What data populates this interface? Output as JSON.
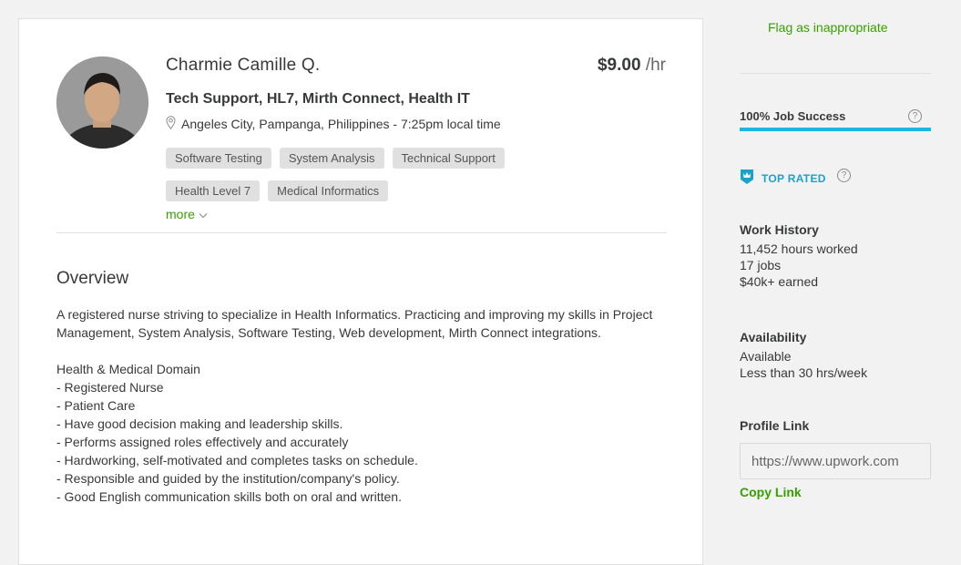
{
  "profile": {
    "name": "Charmie Camille Q.",
    "rate_amount": "$9.00",
    "rate_unit": "/hr",
    "headline": "Tech Support, HL7, Mirth Connect, Health IT",
    "location": "Angeles City, Pampanga, Philippines - 7:25pm local time",
    "skills": [
      "Software Testing",
      "System Analysis",
      "Technical Support",
      "Health Level 7",
      "Medical Informatics"
    ],
    "more_label": "more"
  },
  "overview": {
    "title": "Overview",
    "paragraph": "A registered nurse striving to specialize in Health Informatics. Practicing and improving my skills in Project Management, System Analysis, Software Testing, Web development, Mirth Connect integrations.",
    "lines": [
      "Health & Medical Domain",
      "- Registered Nurse",
      "- Patient Care",
      "- Have good decision making and leadership skills.",
      "- Performs assigned roles effectively and accurately",
      "- Hardworking, self-motivated and completes tasks on schedule.",
      "- Responsible and guided by the institution/company's policy.",
      "- Good English communication skills both on oral and written."
    ]
  },
  "sidebar": {
    "flag_label": "Flag as inappropriate",
    "job_success": "100% Job Success",
    "job_success_pct": 100,
    "top_rated": "TOP RATED",
    "work_history_title": "Work History",
    "hours_worked": "11,452 hours worked",
    "jobs": "17 jobs",
    "earned": "$40k+ earned",
    "availability_title": "Availability",
    "availability_status": "Available",
    "availability_hours": "Less than 30 hrs/week",
    "profile_link_title": "Profile Link",
    "profile_link_value": "https://www.upwork.com",
    "copy_link_label": "Copy Link"
  },
  "colors": {
    "accent_green": "#37a000",
    "accent_blue": "#20b5e0"
  },
  "icons": [
    "location-pin-icon",
    "chevron-down-icon",
    "help-icon",
    "top-rated-badge-icon"
  ]
}
